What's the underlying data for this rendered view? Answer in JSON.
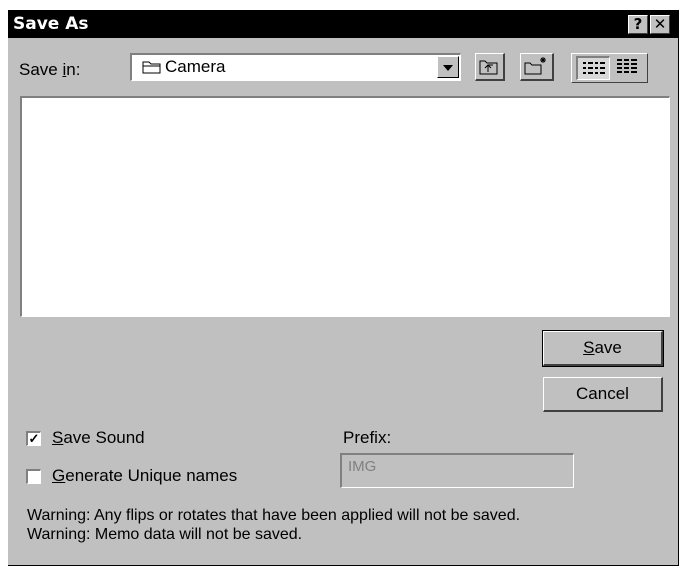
{
  "window": {
    "title": "Save As",
    "help_button": "?",
    "close_button": "✕"
  },
  "save_in": {
    "label_before": "Save ",
    "label_mnemonic": "i",
    "label_after": "n:",
    "selected_folder": "Camera"
  },
  "toolbar": {
    "icons": [
      "up-one-level-icon",
      "create-new-folder-icon",
      "list-view-icon",
      "details-view-icon"
    ]
  },
  "buttons": {
    "save_mnemonic": "S",
    "save_rest": "ave",
    "cancel_label": "Cancel"
  },
  "options": {
    "save_sound": {
      "checked": true,
      "mnemonic": "S",
      "rest": "ave Sound"
    },
    "unique_names": {
      "checked": false,
      "mnemonic": "G",
      "rest": "enerate Unique names"
    }
  },
  "prefix": {
    "label": "Prefix:",
    "value": "IMG"
  },
  "warnings": [
    "Warning: Any flips or rotates that have been applied will not be saved.",
    "Warning: Memo data will not be saved."
  ]
}
